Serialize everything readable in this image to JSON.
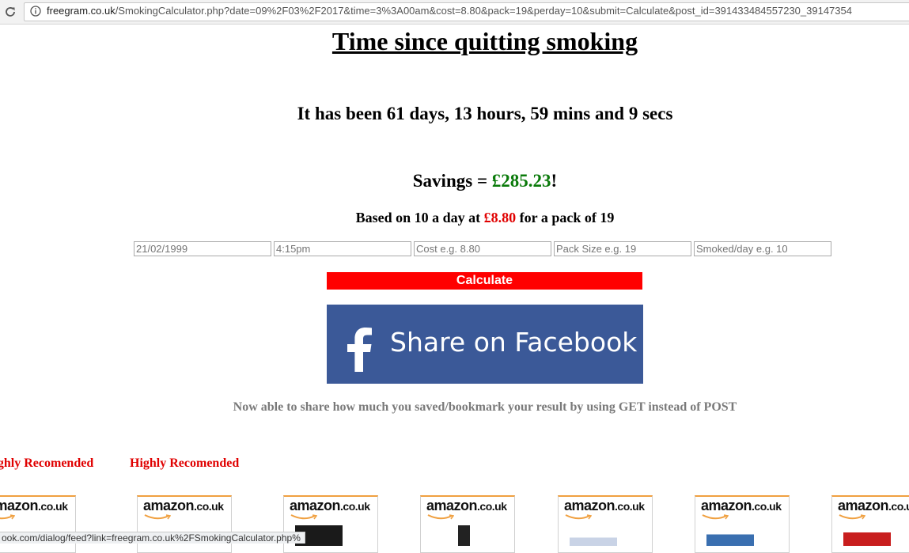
{
  "browser": {
    "url_host": "freegram.co.uk",
    "url_path": "/SmokingCalculator.php?date=09%2F03%2F2017&time=3%3A00am&cost=8.80&pack=19&perday=10&submit=Calculate&post_id=391433484557230_39147354"
  },
  "page": {
    "title": "Time since quitting smoking",
    "elapsed": "It has been 61 days, 13 hours, 59 mins and 9 secs",
    "savings_label": "Savings = ",
    "savings_amount": "£285.23",
    "savings_suffix": "!",
    "basis_prefix": "Based on 10 a day at ",
    "basis_price": "£8.80",
    "basis_suffix": " for a pack of 19"
  },
  "form": {
    "date_placeholder": "21/02/1999",
    "time_placeholder": "4:15pm",
    "cost_placeholder": "Cost e.g. 8.80",
    "pack_placeholder": "Pack Size e.g. 19",
    "perday_placeholder": "Smoked/day e.g. 10",
    "calculate_label": "Calculate"
  },
  "facebook": {
    "share_label": "Share on Facebook",
    "logo": "facebook-f-icon"
  },
  "note": "Now able to share how much you saved/bookmark your result by using GET instead of POST",
  "recommended": [
    {
      "label": "Highly Recomended"
    },
    {
      "label": "Highly Recomended"
    }
  ],
  "ads": [
    {
      "brand": "amazon",
      "tld": ".co.uk"
    },
    {
      "brand": "amazon",
      "tld": ".co.uk"
    },
    {
      "brand": "amazon",
      "tld": ".co.uk"
    },
    {
      "brand": "amazon",
      "tld": ".co.uk"
    },
    {
      "brand": "amazon",
      "tld": ".co.uk"
    },
    {
      "brand": "amazon",
      "tld": ".co.uk"
    },
    {
      "brand": "amazon",
      "tld": ".co.uk"
    }
  ],
  "status_bar": "ook.com/dialog/feed?link=freegram.co.uk%2FSmokingCalculator.php%",
  "colors": {
    "savings_green": "#0a7a0a",
    "price_red": "#e00000",
    "calculate_red": "#ff0000",
    "facebook_blue": "#3b5998",
    "note_grey": "#7a7a7a"
  }
}
